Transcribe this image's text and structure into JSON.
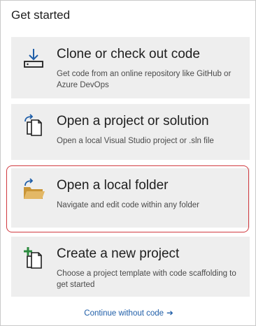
{
  "header": {
    "title": "Get started"
  },
  "cards": [
    {
      "title": "Clone or check out code",
      "description": "Get code from an online repository like GitHub or Azure DevOps",
      "icon": "clone-download-icon"
    },
    {
      "title": "Open a project or solution",
      "description": "Open a local Visual Studio project or .sln file",
      "icon": "open-project-icon"
    },
    {
      "title": "Open a local folder",
      "description": "Navigate and edit code within any folder",
      "icon": "open-folder-icon"
    },
    {
      "title": "Create a new project",
      "description": "Choose a project template with code scaffolding to get started",
      "icon": "new-project-icon"
    }
  ],
  "footer": {
    "continue_label": "Continue without code",
    "continue_arrow": "➔"
  },
  "colors": {
    "card_background": "#eeeeee",
    "highlight_border": "#d0393f",
    "link": "#1f5ea8",
    "icon_accent": "#1f5ea8",
    "add_accent": "#2b8a3e",
    "folder": "#d8a74c"
  }
}
